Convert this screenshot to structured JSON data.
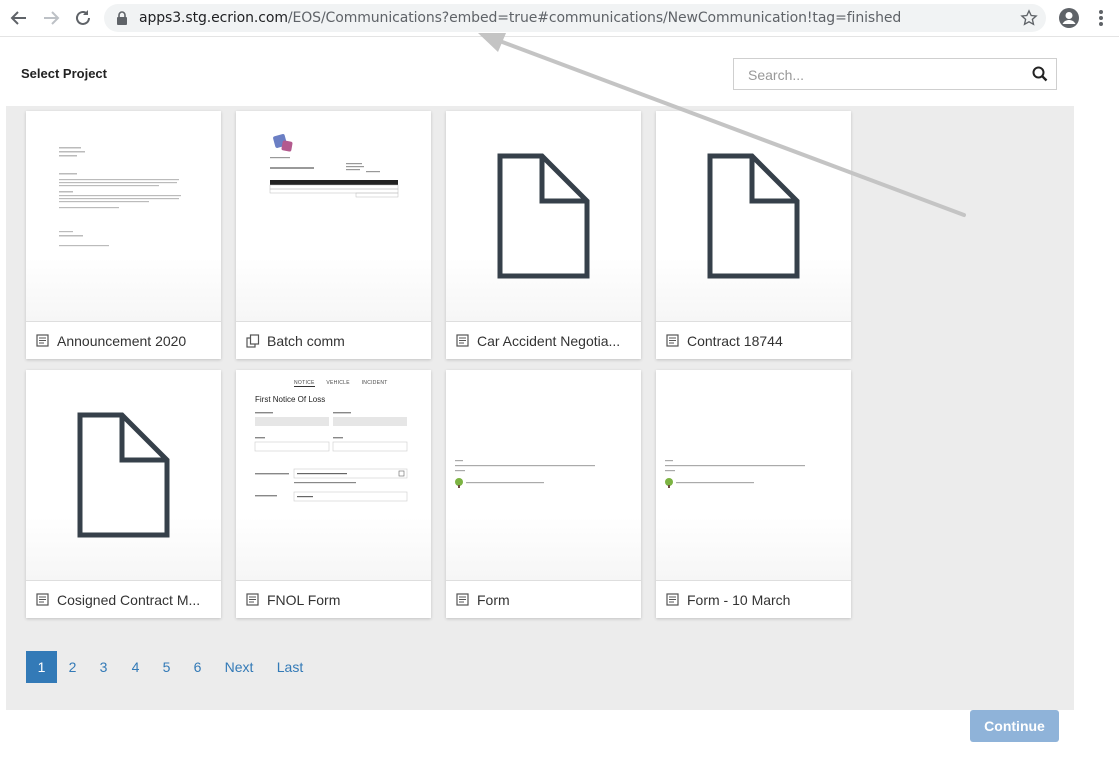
{
  "browser": {
    "url_host": "apps3.stg.ecrion.com",
    "url_path": "/EOS/Communications?embed=true#communications/NewCommunication!tag=finished"
  },
  "header": {
    "title": "Select Project",
    "search_placeholder": "Search..."
  },
  "cards": [
    {
      "label": "Announcement 2020",
      "type_icon": "document-template-icon"
    },
    {
      "label": "Batch comm",
      "type_icon": "batch-icon"
    },
    {
      "label": "Car Accident Negotia...",
      "type_icon": "document-template-icon"
    },
    {
      "label": "Contract 18744",
      "type_icon": "document-template-icon"
    },
    {
      "label": "Cosigned Contract M...",
      "type_icon": "document-template-icon"
    },
    {
      "label": "FNOL Form",
      "type_icon": "document-template-icon"
    },
    {
      "label": "Form",
      "type_icon": "document-template-icon"
    },
    {
      "label": "Form - 10 March",
      "type_icon": "document-template-icon"
    }
  ],
  "fnol_preview": {
    "tabs": [
      "NOTICE",
      "VEHICLE",
      "INCIDENT"
    ],
    "title": "First Notice Of Loss"
  },
  "pagination": {
    "pages": [
      "1",
      "2",
      "3",
      "4",
      "5",
      "6"
    ],
    "active": "1",
    "next": "Next",
    "last": "Last"
  },
  "footer": {
    "continue_label": "Continue"
  },
  "colors": {
    "accent": "#337ab7",
    "continue_disabled": "#8fb3d9",
    "panel": "#ececec"
  }
}
